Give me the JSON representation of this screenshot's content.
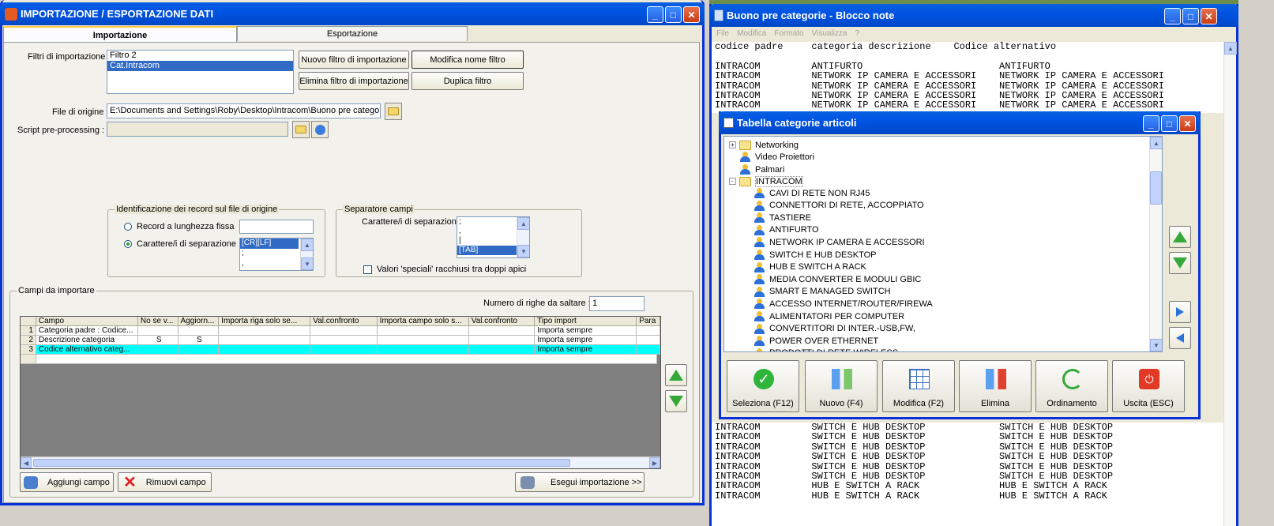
{
  "taskbar_strip": {
    "color": "#6b8e4e"
  },
  "import_window": {
    "title": "IMPORTAZIONE / ESPORTAZIONE DATI",
    "tabs": [
      "Importazione",
      "Esportazione"
    ],
    "filters_label": "Filtri di importazione :",
    "filters": [
      "Filtro 2",
      "Cat.Intracom"
    ],
    "btn_new_filter": "Nuovo filtro di importazione",
    "btn_rename_filter": "Modifica nome filtro",
    "btn_delete_filter": "Elimina filtro di importazione",
    "btn_duplicate_filter": "Duplica filtro",
    "source_label": "File di origine :",
    "source_value": "E:\\Documents and Settings\\Roby\\Desktop\\Intracom\\Buono pre categori",
    "script_label": "Script pre-processing :",
    "record_group": "Identificazione dei record sul file di origine",
    "record_fixed": "Record a lunghezza fissa",
    "record_sep": "Carattere/i di separazione",
    "record_sep_items": [
      "[CR][LF]",
      ";",
      ","
    ],
    "field_sep_group": "Separatore campi",
    "field_sep_label": "Carattere/i di separazione",
    "field_sep_items": [
      ";",
      ",",
      "|",
      "[TAB]"
    ],
    "quotes_label": "Valori 'speciali' racchiusi tra doppi apici",
    "fields_group": "Campi da importare",
    "skip_label": "Numero di righe da saltare :",
    "skip_value": "1",
    "columns": [
      "Campo",
      "No se v...",
      "Aggiorn...",
      "Importa riga solo se...",
      "Val.confronto",
      "Importa campo solo s...",
      "Val.confronto",
      "Tipo import",
      "Para"
    ],
    "rows": [
      {
        "n": "1",
        "campo": "Categoria padre : Codice...",
        "nosev": "",
        "aggiorn": "",
        "tipo": "Importa sempre"
      },
      {
        "n": "2",
        "campo": "Descrizione categoria",
        "nosev": "S",
        "aggiorn": "S",
        "tipo": "Importa sempre"
      },
      {
        "n": "3",
        "campo": "Codice alternativo categ...",
        "nosev": "",
        "aggiorn": "",
        "tipo": "Importa sempre"
      }
    ],
    "btn_add": "Aggiungi campo",
    "btn_remove": "Rimuovi campo",
    "btn_run": "Esegui importazione >>"
  },
  "notepad": {
    "title": "Buono pre categorie - Blocco note",
    "menu": [
      "File",
      "Modifica",
      "Formato",
      "Visualizza",
      "?"
    ],
    "text_top": "codice padre     categoria descrizione    Codice alternativo\n\nINTRACOM         ANTIFURTO                        ANTIFURTO\nINTRACOM         NETWORK IP CAMERA E ACCESSORI    NETWORK IP CAMERA E ACCESSORI\nINTRACOM         NETWORK IP CAMERA E ACCESSORI    NETWORK IP CAMERA E ACCESSORI\nINTRACOM         NETWORK IP CAMERA E ACCESSORI    NETWORK IP CAMERA E ACCESSORI\nINTRACOM         NETWORK IP CAMERA E ACCESSORI    NETWORK IP CAMERA E ACCESSORI",
    "text_bottom": "INTRACOM         SWITCH E HUB DESKTOP             SWITCH E HUB DESKTOP\nINTRACOM         SWITCH E HUB DESKTOP             SWITCH E HUB DESKTOP\nINTRACOM         SWITCH E HUB DESKTOP             SWITCH E HUB DESKTOP\nINTRACOM         SWITCH E HUB DESKTOP             SWITCH E HUB DESKTOP\nINTRACOM         SWITCH E HUB DESKTOP             SWITCH E HUB DESKTOP\nINTRACOM         SWITCH E HUB DESKTOP             SWITCH E HUB DESKTOP\nINTRACOM         HUB E SWITCH A RACK              HUB E SWITCH A RACK\nINTRACOM         HUB E SWITCH A RACK              HUB E SWITCH A RACK"
  },
  "categories": {
    "title": "Tabella categorie articoli",
    "top_items": [
      {
        "label": "Networking",
        "type": "folder",
        "expand": "+"
      },
      {
        "label": "Video Proiettori",
        "type": "user",
        "expand": ""
      },
      {
        "label": "Palmari",
        "type": "user",
        "expand": ""
      },
      {
        "label": "INTRACOM",
        "type": "folder",
        "expand": "-"
      }
    ],
    "children": [
      "CAVI DI RETE NON RJ45",
      "CONNETTORI DI RETE, ACCOPPIATO",
      "TASTIERE",
      "ANTIFURTO",
      "NETWORK IP CAMERA E ACCESSORI",
      "SWITCH E HUB DESKTOP",
      "HUB E SWITCH A RACK",
      "MEDIA CONVERTER E MODULI GBIC",
      "SMART E MANAGED SWITCH",
      "ACCESSO INTERNET/ROUTER/FIREWA",
      "ALIMENTATORI PER COMPUTER",
      "CONVERTITORI DI INTER.-USB,FW,",
      "POWER OVER ETHERNET",
      "PRODOTTI DI RETE WIRELESS"
    ],
    "buttons": [
      "Seleziona (F12)",
      "Nuovo (F4)",
      "Modifica (F2)",
      "Elimina",
      "Ordinamento",
      "Uscita (ESC)"
    ]
  }
}
